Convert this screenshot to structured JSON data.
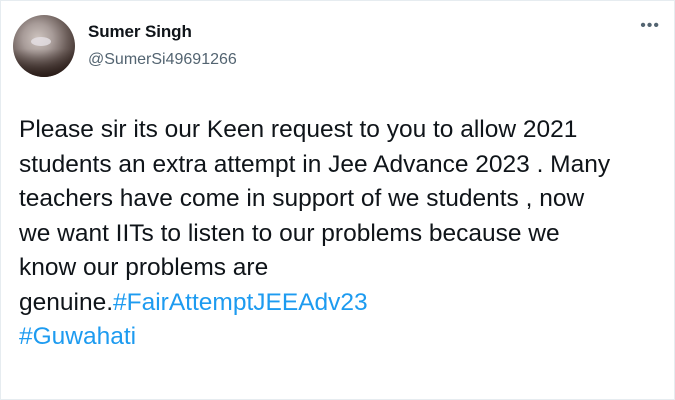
{
  "tweet": {
    "author_name": "Sumer Singh",
    "author_handle": "@SumerSi49691266",
    "more_icon": "ellipsis-icon",
    "more_label": "•••",
    "lines": [
      "Please sir its our Keen request to you to allow 2021",
      "students an extra attempt in Jee Advance 2023 . Many",
      "teachers have come in support of we students , now",
      "we want IITs to listen to our problems because we",
      "know our problems are"
    ],
    "last_line_prefix": "genuine.",
    "hashtags": [
      "#FairAttemptJEEAdv23",
      "#Guwahati"
    ]
  },
  "colors": {
    "text": "#0f1419",
    "secondary": "#536471",
    "link": "#1d9bf0",
    "background": "#ffffff"
  }
}
